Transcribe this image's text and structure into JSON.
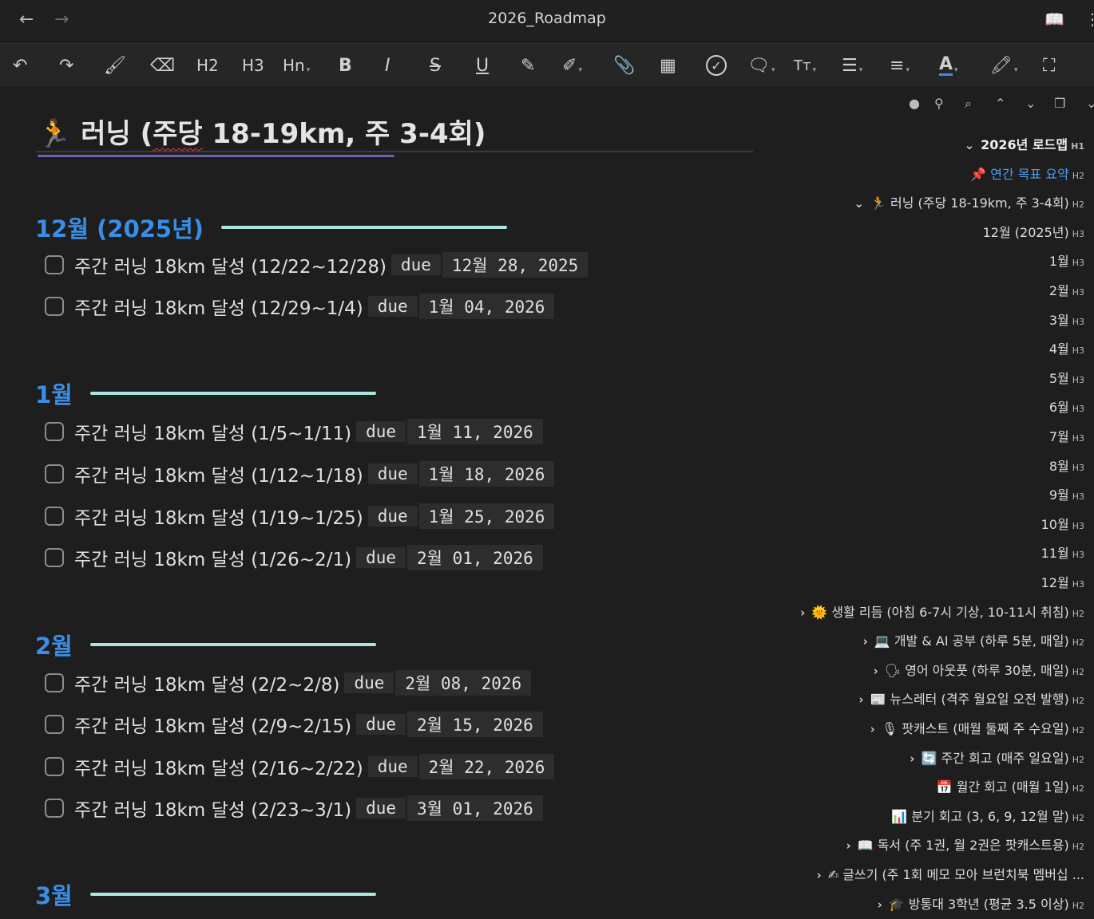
{
  "window": {
    "title": "2026_Roadmap",
    "back_icon": "←",
    "forward_icon": "→",
    "reader_icon": "📖",
    "more_icon": "⋮"
  },
  "toolbar": {
    "undo": "↶",
    "redo": "↷",
    "format_painter": "🖌",
    "eraser": "⌫",
    "h2": "H2",
    "h3": "H3",
    "hn": "Hn",
    "bold": "B",
    "italic": "I",
    "strike": "S",
    "underline": "U",
    "highlight_pen": "✎",
    "edit": "✐",
    "attach": "📎",
    "table": "▦",
    "check": "✓",
    "comment": "🗨",
    "text_size": "Tт",
    "list": "☰",
    "align": "≡",
    "font_color": "A",
    "highlight": "🖍",
    "fullscreen": "⛶"
  },
  "doc": {
    "heading_emoji": "🏃",
    "heading_pre": "러닝 (",
    "heading_squiggle": "주당",
    "heading_post": " 18-19km, 주 3-4회)",
    "sections": [
      {
        "title": "12월 (2025년)",
        "tasks": [
          {
            "text": "주간 러닝 18km 달성 (12/22~12/28)",
            "due": "due",
            "date": "12월 28, 2025"
          },
          {
            "text": "주간 러닝 18km 달성 (12/29~1/4)",
            "due": "due",
            "date": "1월 04, 2026"
          }
        ]
      },
      {
        "title": "1월",
        "tasks": [
          {
            "text": "주간 러닝 18km 달성 (1/5~1/11)",
            "due": "due",
            "date": "1월 11, 2026"
          },
          {
            "text": "주간 러닝 18km 달성 (1/12~1/18)",
            "due": "due",
            "date": "1월 18, 2026"
          },
          {
            "text": "주간 러닝 18km 달성 (1/19~1/25)",
            "due": "due",
            "date": "1월 25, 2026"
          },
          {
            "text": "주간 러닝 18km 달성 (1/26~2/1)",
            "due": "due",
            "date": "2월 01, 2026"
          }
        ]
      },
      {
        "title": "2월",
        "tasks": [
          {
            "text": "주간 러닝 18km 달성 (2/2~2/8)",
            "due": "due",
            "date": "2월 08, 2026"
          },
          {
            "text": "주간 러닝 18km 달성 (2/9~2/15)",
            "due": "due",
            "date": "2월 15, 2026"
          },
          {
            "text": "주간 러닝 18km 달성 (2/16~2/22)",
            "due": "due",
            "date": "2월 22, 2026"
          },
          {
            "text": "주간 러닝 18km 달성 (2/23~3/1)",
            "due": "due",
            "date": "3월 01, 2026"
          }
        ]
      },
      {
        "title": "3월",
        "tasks": []
      }
    ]
  },
  "outline": {
    "toolbar_icons": [
      "●",
      "⚲",
      "⌕",
      "⌃",
      "⌄",
      "❐",
      "⌄"
    ],
    "items": [
      {
        "chev": "⌄",
        "text": "2026년 로드맵",
        "level": "H1"
      },
      {
        "chev": "",
        "text": "📌 연간 목표 요약",
        "level": "H2"
      },
      {
        "chev": "⌄",
        "text": "🏃 러닝 (주당 18-19km, 주 3-4회)",
        "level": "H2"
      },
      {
        "chev": "",
        "text": "12월 (2025년)",
        "level": "H3"
      },
      {
        "chev": "",
        "text": "1월",
        "level": "H3"
      },
      {
        "chev": "",
        "text": "2월",
        "level": "H3"
      },
      {
        "chev": "",
        "text": "3월",
        "level": "H3"
      },
      {
        "chev": "",
        "text": "4월",
        "level": "H3"
      },
      {
        "chev": "",
        "text": "5월",
        "level": "H3"
      },
      {
        "chev": "",
        "text": "6월",
        "level": "H3"
      },
      {
        "chev": "",
        "text": "7월",
        "level": "H3"
      },
      {
        "chev": "",
        "text": "8월",
        "level": "H3"
      },
      {
        "chev": "",
        "text": "9월",
        "level": "H3"
      },
      {
        "chev": "",
        "text": "10월",
        "level": "H3"
      },
      {
        "chev": "",
        "text": "11월",
        "level": "H3"
      },
      {
        "chev": "",
        "text": "12월",
        "level": "H3"
      },
      {
        "chev": "›",
        "text": "🌞 생활 리듬 (아침 6-7시 기상, 10-11시 취침)",
        "level": "H2"
      },
      {
        "chev": "›",
        "text": "💻 개발 & AI 공부 (하루 5분, 매일)",
        "level": "H2"
      },
      {
        "chev": "›",
        "text": "🗣 영어 아웃풋 (하루 30분, 매일)",
        "level": "H2"
      },
      {
        "chev": "›",
        "text": "📰 뉴스레터 (격주 월요일 오전 발행)",
        "level": "H2"
      },
      {
        "chev": "›",
        "text": "🎙 팟캐스트 (매월 둘째 주 수요일)",
        "level": "H2"
      },
      {
        "chev": "›",
        "text": "🔄 주간 회고 (매주 일요일)",
        "level": "H2"
      },
      {
        "chev": "",
        "text": "📅 월간 회고 (매월 1일)",
        "level": "H2"
      },
      {
        "chev": "",
        "text": "📊 분기 회고 (3, 6, 9, 12월 말)",
        "level": "H2"
      },
      {
        "chev": "›",
        "text": "📖 독서 (주 1권, 월 2권은 팟캐스트용)",
        "level": "H2"
      },
      {
        "chev": "›",
        "text": "✍ 글쓰기 (주 1회 메모 모아 브런치북 멤버십 ...",
        "level": ""
      },
      {
        "chev": "›",
        "text": "🎓 방통대 3학년 (평균 3.5 이상)",
        "level": "H2"
      }
    ]
  }
}
